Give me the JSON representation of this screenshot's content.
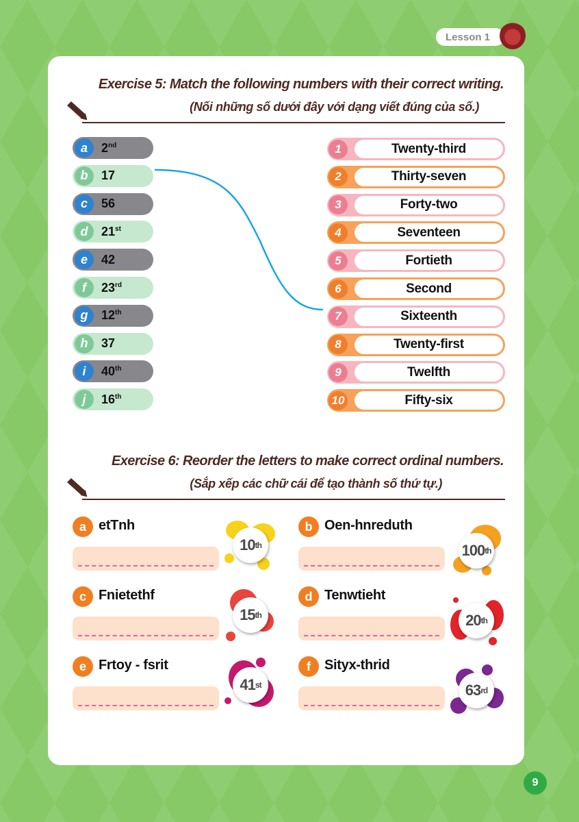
{
  "header": {
    "lesson_label": "Lesson 1",
    "avatar_icon": "girl-avatar-icon"
  },
  "exercise5": {
    "title": "Exercise 5: Match the following numbers with their correct writing.",
    "subtitle": "(Nối những số dưới đây với dạng viết đúng của số.)",
    "left_items": [
      {
        "letter": "a",
        "number": "2",
        "suffix": "nd",
        "style": "gray"
      },
      {
        "letter": "b",
        "number": "17",
        "suffix": "",
        "style": "green"
      },
      {
        "letter": "c",
        "number": "56",
        "suffix": "",
        "style": "gray"
      },
      {
        "letter": "d",
        "number": "21",
        "suffix": "st",
        "style": "green"
      },
      {
        "letter": "e",
        "number": "42",
        "suffix": "",
        "style": "gray"
      },
      {
        "letter": "f",
        "number": "23",
        "suffix": "rd",
        "style": "green"
      },
      {
        "letter": "g",
        "number": "12",
        "suffix": "th",
        "style": "gray"
      },
      {
        "letter": "h",
        "number": "37",
        "suffix": "",
        "style": "green"
      },
      {
        "letter": "i",
        "number": "40",
        "suffix": "th",
        "style": "gray"
      },
      {
        "letter": "j",
        "number": "16",
        "suffix": "th",
        "style": "green"
      }
    ],
    "right_items": [
      {
        "num": "1",
        "text": "Twenty-third",
        "style": "pink"
      },
      {
        "num": "2",
        "text": "Thirty-seven",
        "style": "orange"
      },
      {
        "num": "3",
        "text": "Forty-two",
        "style": "pink"
      },
      {
        "num": "4",
        "text": "Seventeen",
        "style": "orange"
      },
      {
        "num": "5",
        "text": "Fortieth",
        "style": "pink"
      },
      {
        "num": "6",
        "text": "Second",
        "style": "orange"
      },
      {
        "num": "7",
        "text": "Sixteenth",
        "style": "pink"
      },
      {
        "num": "8",
        "text": "Twenty-first",
        "style": "orange"
      },
      {
        "num": "9",
        "text": "Twelfth",
        "style": "pink"
      },
      {
        "num": "10",
        "text": "Fifty-six",
        "style": "orange"
      }
    ],
    "example_match": {
      "from": "b",
      "to": "7",
      "line_color": "#1aa6e6"
    }
  },
  "exercise6": {
    "title": "Exercise 6: Reorder the letters to make correct ordinal numbers.",
    "subtitle": "(Sắp xếp các chữ cái để tạo thành số thứ tự.)",
    "items": [
      {
        "letter": "a",
        "scrambled": "etTnh",
        "answer": "",
        "hint_number": "10",
        "hint_suffix": "th",
        "blob_color": "#f7d21b"
      },
      {
        "letter": "b",
        "scrambled": "Oen-hnreduth",
        "answer": "",
        "hint_number": "100",
        "hint_suffix": "th",
        "blob_color": "#f5a11f"
      },
      {
        "letter": "c",
        "scrambled": "Fnietethf",
        "answer": "",
        "hint_number": "15",
        "hint_suffix": "th",
        "blob_color": "#e8453c"
      },
      {
        "letter": "d",
        "scrambled": "Tenwtieht",
        "answer": "",
        "hint_number": "20",
        "hint_suffix": "th",
        "blob_color": "#e2232a"
      },
      {
        "letter": "e",
        "scrambled": "Frtoy - fsrit",
        "answer": "",
        "hint_number": "41",
        "hint_suffix": "st",
        "blob_color": "#c4196e"
      },
      {
        "letter": "f",
        "scrambled": "Sityx-thrid",
        "answer": "",
        "hint_number": "63",
        "hint_suffix": "rd",
        "blob_color": "#7b2891"
      }
    ]
  },
  "footer": {
    "page_number": "9"
  }
}
